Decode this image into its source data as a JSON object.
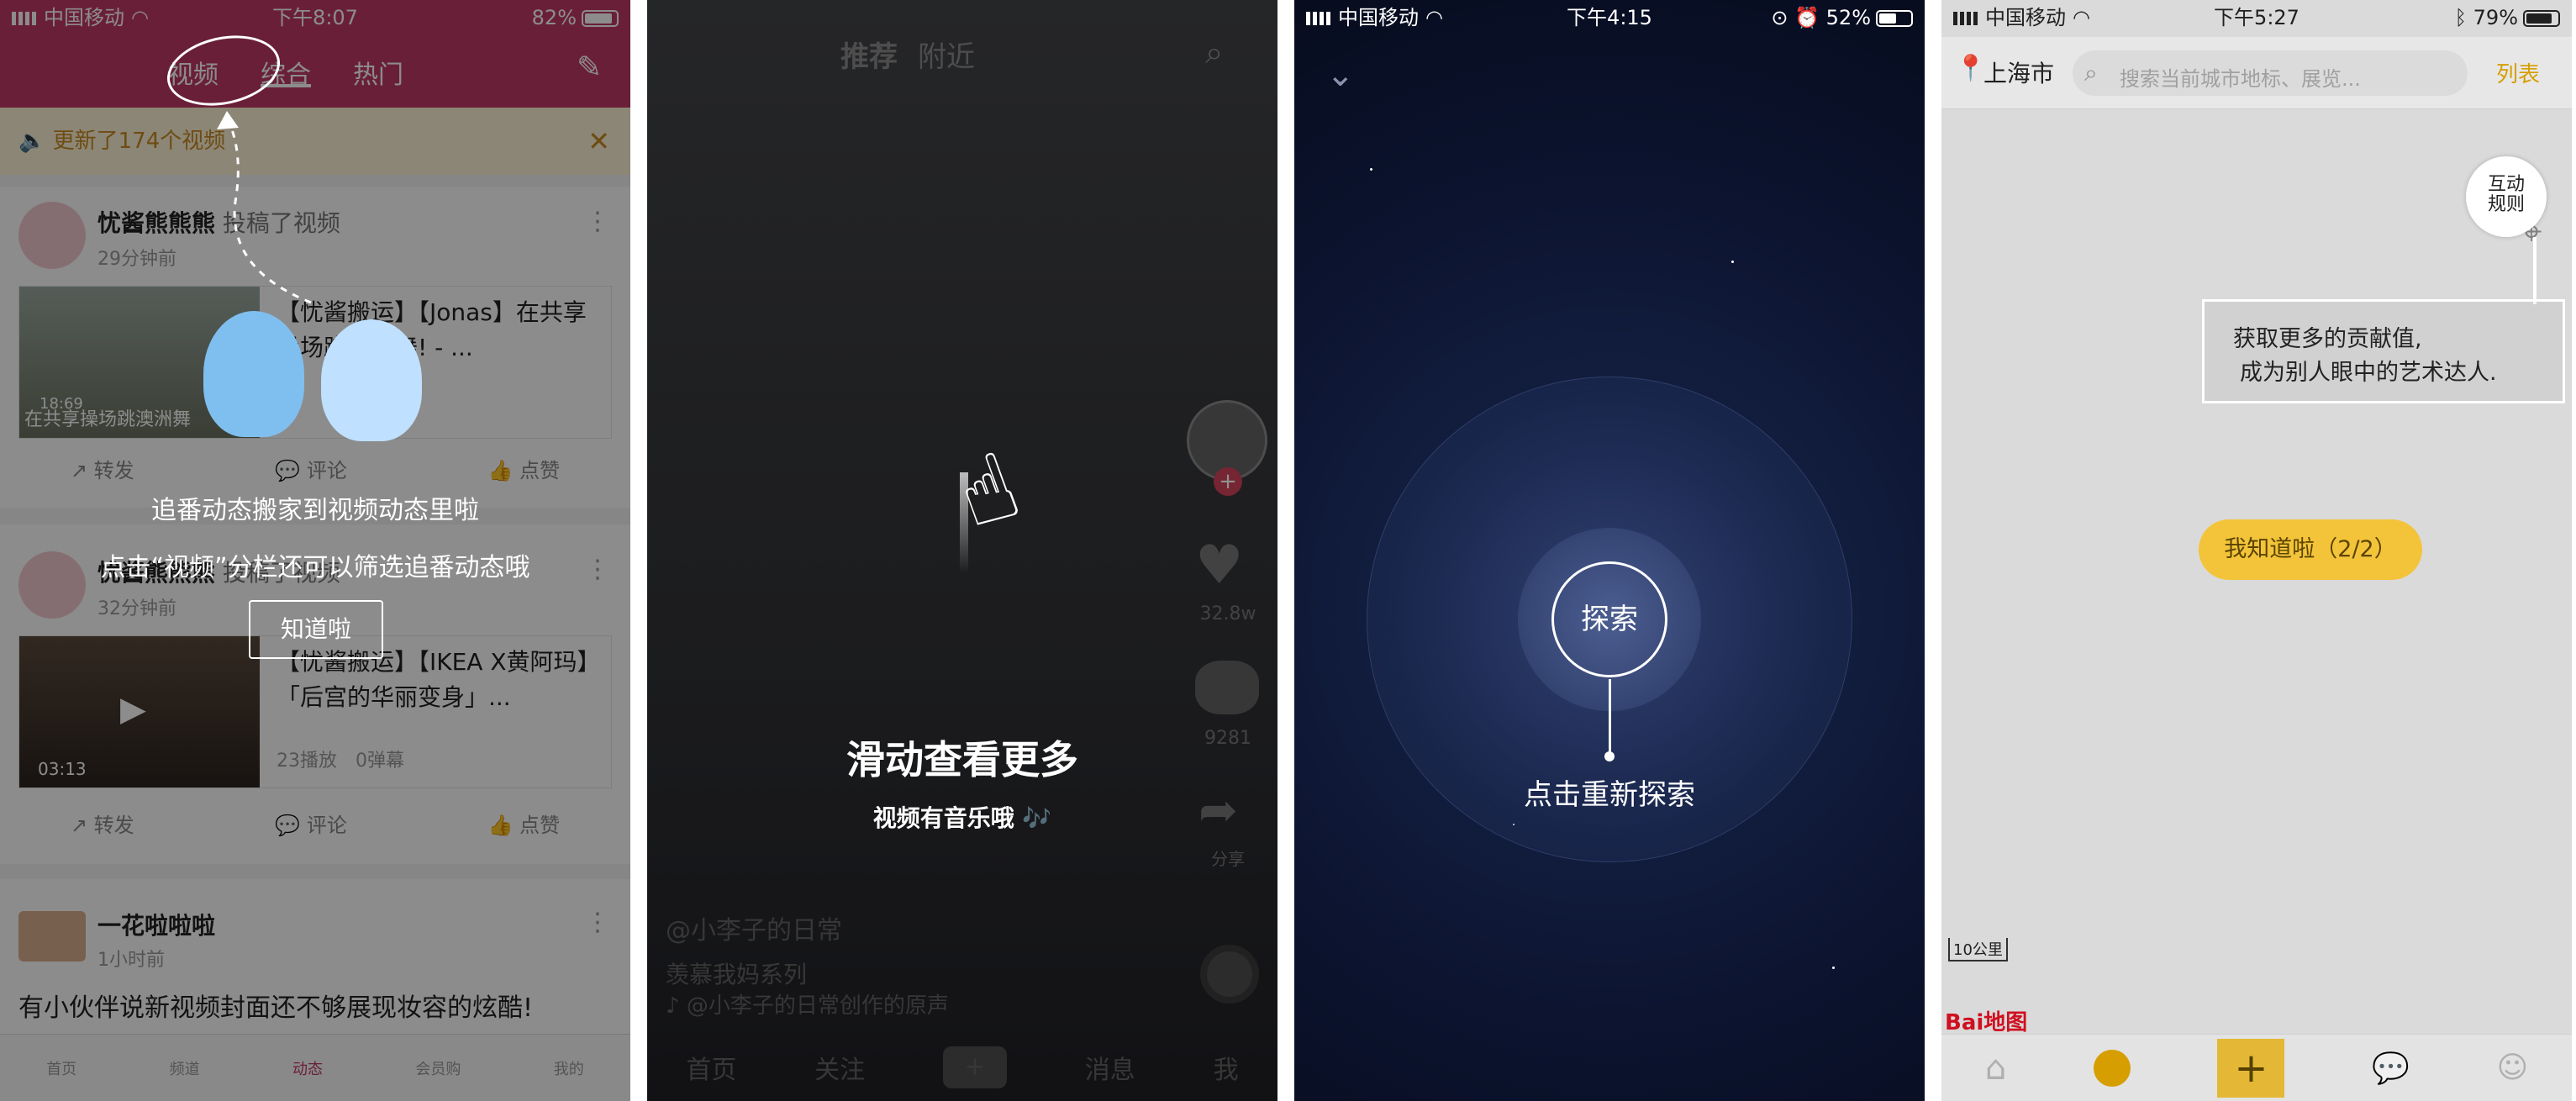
{
  "p1": {
    "status": {
      "carrier": "中国移动",
      "time": "下午8:07",
      "battery": "82%",
      "battery_level": 0.82
    },
    "tabs": [
      "视频",
      "综合",
      "热门"
    ],
    "notice": "更新了174个视频",
    "post1": {
      "name": "忧酱熊熊熊",
      "action": "投稿了视频",
      "time": "29分钟前",
      "title": "【忧酱搬运】【Jonas】在共享操场跳澳洲舞! - ...",
      "thumb_caption": "在共享操场跳澳洲舞",
      "duration": "18:69",
      "actions": [
        "转发",
        "评论",
        "点赞"
      ]
    },
    "post2": {
      "name": "忧酱熊熊熊",
      "action": "投稿了视频",
      "time": "32分钟前",
      "title": "【忧酱搬运】【IKEA X黄阿玛】「后宫的华丽变身」...",
      "stats": "23播放　0弹幕",
      "duration": "03:13",
      "actions": [
        "转发",
        "评论",
        "点赞"
      ]
    },
    "post3": {
      "name": "一花啦啦啦",
      "time": "1小时前",
      "text": "有小伙伴说新视频封面还不够展现妆容的炫酷!"
    },
    "tip1": "追番动态搬家到视频动态里啦",
    "tip2": "点击“视频”分栏还可以筛选追番动态哦",
    "tip_button": "知道啦",
    "bottom_nav": [
      "首页",
      "频道",
      "动态",
      "会员购",
      "我的"
    ]
  },
  "p2": {
    "tabs": [
      "推荐",
      "附近"
    ],
    "likes": "32.8w",
    "comments": "9281",
    "share": "分享",
    "tip_title": "滑动查看更多",
    "tip_sub": "视频有音乐哦 🎶",
    "author": "@小李子的日常",
    "desc": "羡慕我妈系列",
    "music": "@小李子的日常创作的原声",
    "bottom_nav": [
      "首页",
      "关注",
      "+",
      "消息",
      "我"
    ]
  },
  "p3": {
    "status": {
      "carrier": "中国移动",
      "time": "下午4:15",
      "battery": "52%",
      "battery_level": 0.52
    },
    "explore": "探索",
    "tip": "点击重新探索"
  },
  "p4": {
    "status": {
      "carrier": "中国移动",
      "time": "下午5:27",
      "battery": "79%",
      "battery_level": 0.79
    },
    "city": "上海市",
    "search_placeholder": "搜索当前城市地标、展览...",
    "list": "列表",
    "interact_line1": "互动",
    "interact_line2": "规则",
    "tip_line1": "获取更多的贡献值,",
    "tip_line2": "成为别人眼中的艺术达人.",
    "button": "我知道啦（2/2）",
    "scale": "10公里",
    "logo": "Bai地图"
  },
  "colors": {
    "bili_pink": "#c23a66",
    "gold": "#f3c43a",
    "gold_text": "#5b4400"
  }
}
